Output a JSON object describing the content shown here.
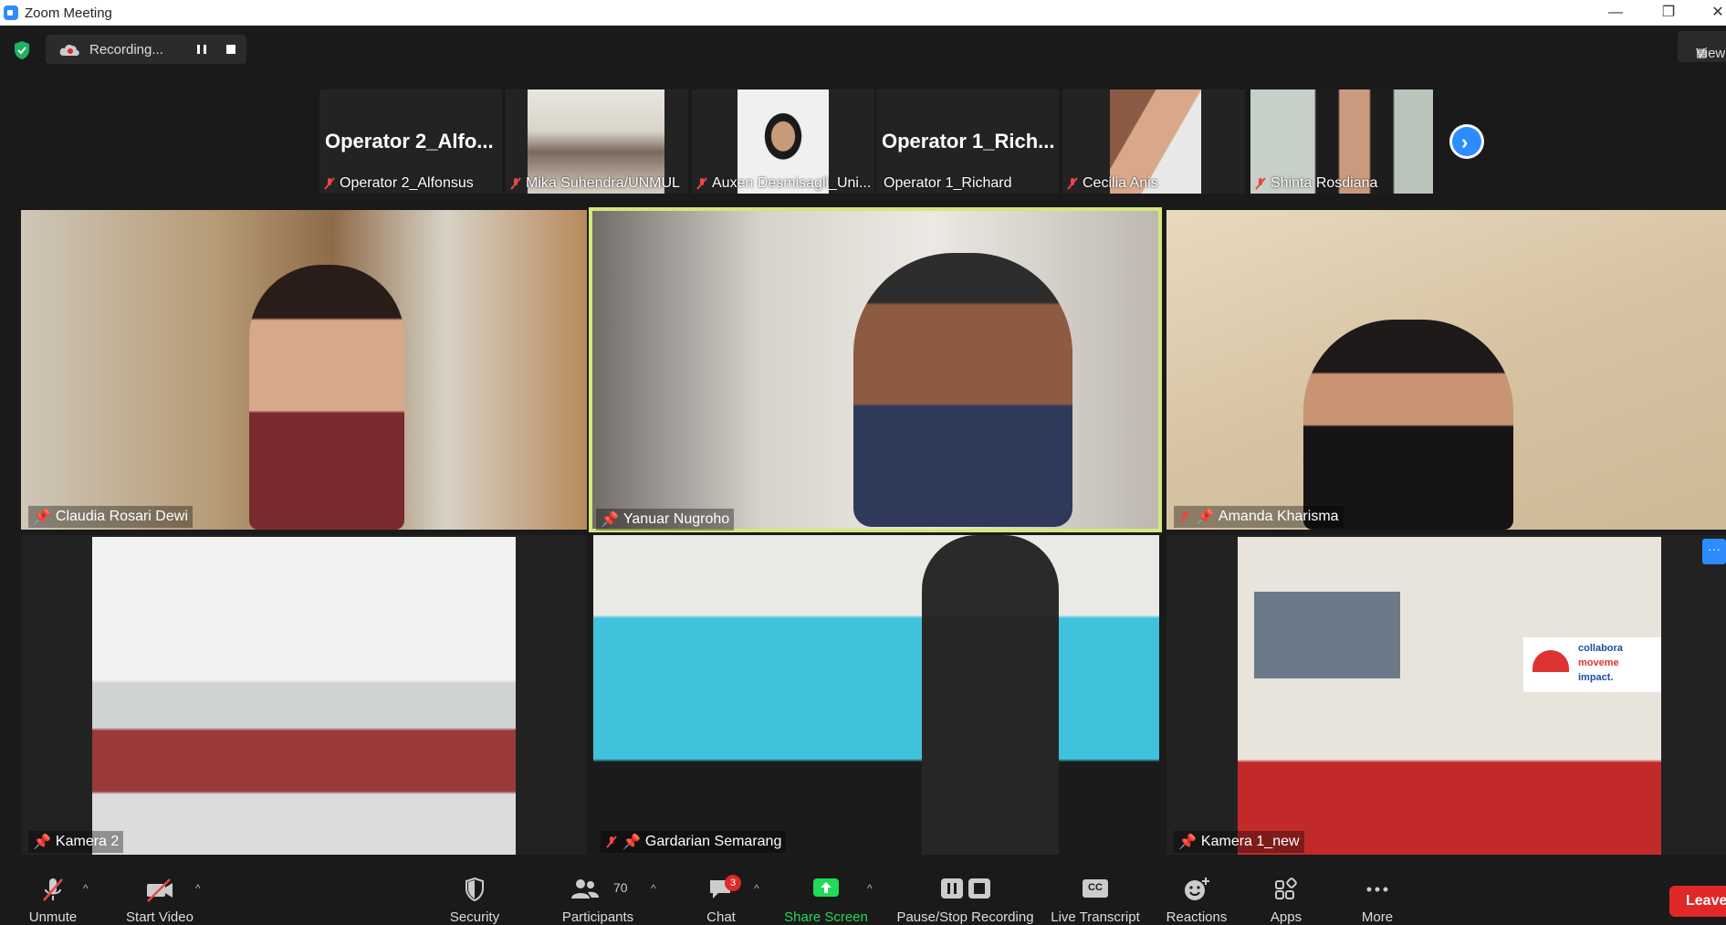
{
  "window": {
    "title": "Zoom Meeting",
    "minimize": "—",
    "restore": "❐",
    "close": "✕"
  },
  "recording": {
    "label": "Recording..."
  },
  "view": {
    "label": "View"
  },
  "thumbnails": [
    {
      "display_name": "Operator  2_Alfo...",
      "label": "Operator 2_Alfonsus",
      "muted": true
    },
    {
      "display_name": "",
      "label": "Mika Suhendra/UNMUL",
      "muted": true
    },
    {
      "display_name": "",
      "label": "Auxen Desmisagli_Uni...",
      "muted": true
    },
    {
      "display_name": "Operator  1_Rich...",
      "label": "Operator 1_Richard",
      "muted": false
    },
    {
      "display_name": "",
      "label": "Cecilia Anis",
      "muted": true
    },
    {
      "display_name": "",
      "label": "Shinta Rosdiana",
      "muted": true
    }
  ],
  "tiles": [
    {
      "name": "Claudia Rosari Dewi",
      "pinned": true,
      "muted": false
    },
    {
      "name": "Yanuar Nugroho",
      "pinned": true,
      "muted": false,
      "active_speaker": true
    },
    {
      "name": "Amanda Kharisma",
      "pinned": true,
      "muted": true
    },
    {
      "name": "Kamera 2",
      "pinned": true,
      "muted": false
    },
    {
      "name": "Gardarian Semarang",
      "pinned": true,
      "muted": true
    },
    {
      "name": "Kamera 1_new",
      "pinned": true,
      "muted": false
    }
  ],
  "toolbar": {
    "unmute": "Unmute",
    "start_video": "Start Video",
    "security": "Security",
    "participants": "Participants",
    "participants_count": "70",
    "chat": "Chat",
    "chat_badge": "3",
    "share_screen": "Share Screen",
    "pause_stop_recording": "Pause/Stop Recording",
    "live_transcript": "Live Transcript",
    "live_transcript_icon": "CC",
    "reactions": "Reactions",
    "apps": "Apps",
    "more": "More",
    "leave": "Leave"
  },
  "banner_text": {
    "line1": "collabora",
    "line2": "moveme",
    "line3": "impact."
  },
  "colors": {
    "accent": "#2d8cff",
    "active_border": "#d6e77a",
    "leave": "#e02828",
    "share": "#23d959"
  }
}
